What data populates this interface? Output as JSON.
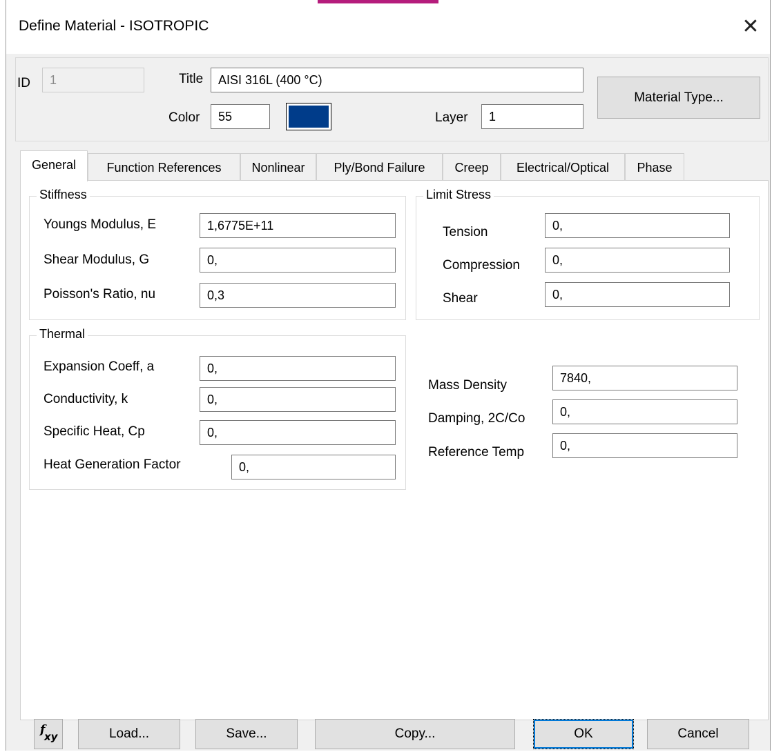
{
  "window": {
    "title": "Define Material - ISOTROPIC",
    "close_glyph": "✕"
  },
  "header": {
    "id_label": "ID",
    "id_value": "1",
    "title_label": "Title",
    "title_value": "AISI 316L (400 °C)",
    "color_label": "Color",
    "color_value": "55",
    "color_swatch_hex": "#003c8a",
    "layer_label": "Layer",
    "layer_value": "1",
    "material_type_button": "Material Type..."
  },
  "tabs": [
    {
      "label": "General",
      "active": true
    },
    {
      "label": "Function References",
      "active": false
    },
    {
      "label": "Nonlinear",
      "active": false
    },
    {
      "label": "Ply/Bond Failure",
      "active": false
    },
    {
      "label": "Creep",
      "active": false
    },
    {
      "label": "Electrical/Optical",
      "active": false
    },
    {
      "label": "Phase",
      "active": false
    }
  ],
  "stiffness": {
    "title": "Stiffness",
    "youngs_label": "Youngs Modulus, E",
    "youngs_value": "1,6775E+11",
    "shear_label": "Shear Modulus, G",
    "shear_value": "0,",
    "poisson_label": "Poisson's Ratio, nu",
    "poisson_value": "0,3"
  },
  "limit_stress": {
    "title": "Limit Stress",
    "tension_label": "Tension",
    "tension_value": "0,",
    "compression_label": "Compression",
    "compression_value": "0,",
    "shear_label": "Shear",
    "shear_value": "0,"
  },
  "thermal": {
    "title": "Thermal",
    "expansion_label": "Expansion Coeff, a",
    "expansion_value": "0,",
    "conductivity_label": "Conductivity, k",
    "conductivity_value": "0,",
    "specific_heat_label": "Specific Heat, Cp",
    "specific_heat_value": "0,",
    "heat_gen_label": "Heat Generation Factor",
    "heat_gen_value": "0,"
  },
  "other": {
    "mass_density_label": "Mass Density",
    "mass_density_value": "7840,",
    "damping_label": "Damping, 2C/Co",
    "damping_value": "0,",
    "ref_temp_label": "Reference Temp",
    "ref_temp_value": "0,"
  },
  "footer": {
    "fxy_icon": "fxy-function-icon",
    "load": "Load...",
    "save": "Save...",
    "copy": "Copy...",
    "ok": "OK",
    "cancel": "Cancel"
  }
}
